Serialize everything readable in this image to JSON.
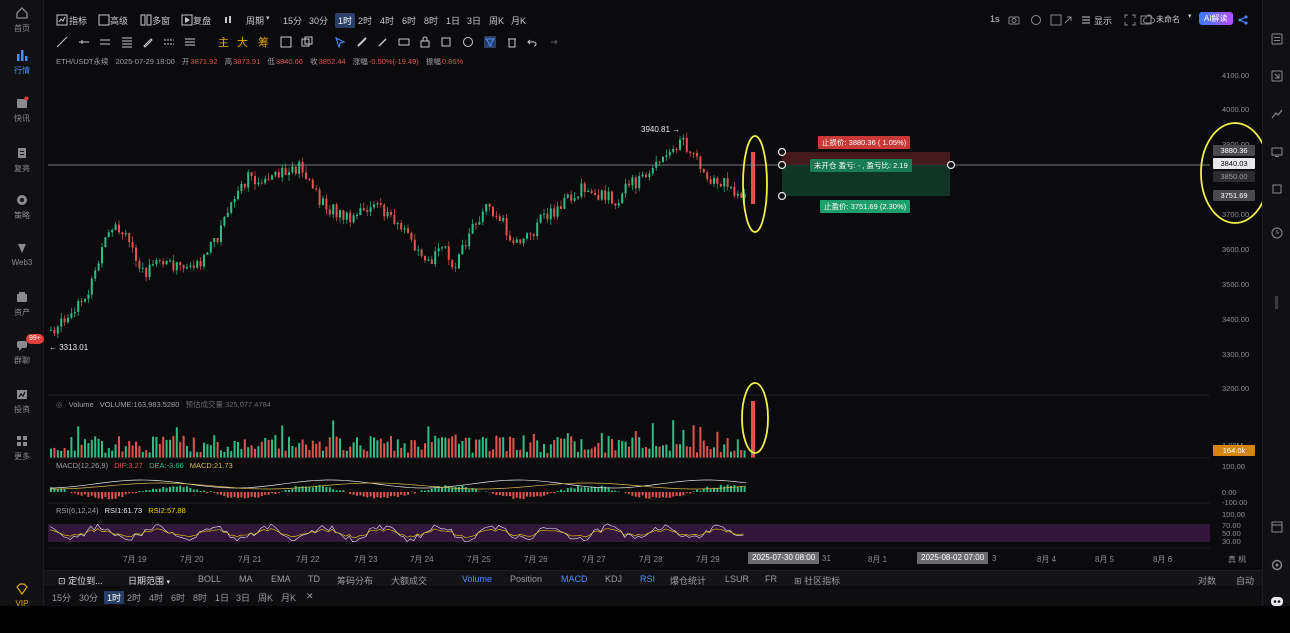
{
  "left_nav": [
    {
      "label": "首页",
      "icon": "home-icon"
    },
    {
      "label": "行情",
      "icon": "chart-bars-icon",
      "active": true
    },
    {
      "label": "快讯",
      "icon": "newsflash-icon"
    },
    {
      "label": "复亮",
      "icon": "document-icon"
    },
    {
      "label": "策略",
      "icon": "strategy-icon"
    },
    {
      "label": "Web3",
      "icon": "web3-icon"
    },
    {
      "label": "资产",
      "icon": "asset-icon"
    },
    {
      "label": "群聊",
      "icon": "chat-icon",
      "badge": "99+"
    },
    {
      "label": "投资",
      "icon": "invest-icon"
    },
    {
      "label": "更多",
      "icon": "more-icon"
    }
  ],
  "vip_label": "VIP",
  "toolbar": {
    "items": [
      "指标",
      "高级",
      "多窗",
      "复盘"
    ],
    "period_label": "周期",
    "timeframes": [
      "15分",
      "30分",
      "1时",
      "2时",
      "4时",
      "6时",
      "8时",
      "1日",
      "3日",
      "周K",
      "月K"
    ],
    "active_timeframe": "1时",
    "right_items": [
      "1s",
      "显示",
      "未命名",
      "AI解读"
    ]
  },
  "drawing_gold": [
    "主",
    "大",
    "筹"
  ],
  "ohlc": {
    "symbol": "ETH/USDT永续",
    "datetime": "2025-07-29 18:00",
    "open_label": "开",
    "open": "3871.92",
    "high_label": "高",
    "high": "3873.91",
    "low_label": "低",
    "low": "3840.66",
    "close_label": "收",
    "close": "3852.44",
    "change_label": "涨幅",
    "change": "-0.50%(-19.49)",
    "amp_label": "振幅",
    "amp": "0.86%"
  },
  "y_axis": [
    "4100.00",
    "4000.00",
    "3900.00",
    "3800.00",
    "3700.00",
    "3600.00",
    "3500.00",
    "3400.00",
    "3300.00",
    "3200.00"
  ],
  "price_tags": {
    "stop_loss_top": "3880.36",
    "current": "3840.03",
    "mid": "3850.00",
    "take_profit": "3751.69"
  },
  "annotations": {
    "high": "3940.81 →",
    "low": "← 3313.01"
  },
  "trade_plan": {
    "stop_loss": "止损价: 3880.36 ( 1.05%)",
    "status": "未开仓  盈亏: - ,  盈亏比: 2.19",
    "take_profit": "止盈价: 3751.69 (2.30%)"
  },
  "volume": {
    "label": "Volume",
    "value": "VOLUME:163,983.5280",
    "est_label": "预估成交量:",
    "est": "325,077.4784",
    "axis": "1.00M",
    "tag": "164.0k"
  },
  "macd": {
    "label": "MACD(12,26,9)",
    "dif": "DIF:3.27",
    "dea": "DEA:-3.66",
    "macd": "MACD:21.73",
    "axis": [
      "100.00",
      "0.00",
      "-100.00"
    ]
  },
  "rsi": {
    "label": "RSI(6,12,24)",
    "rsi1": "RSI1:61.73",
    "rsi2": "RSI2:57.88",
    "axis": [
      "100.00",
      "70.00",
      "50.00",
      "30.00"
    ]
  },
  "x_axis": [
    "7月 19",
    "7月 20",
    "7月 21",
    "7月 22",
    "7月 23",
    "7月 24",
    "7月 25",
    "7月 26",
    "7月 27",
    "7月 28",
    "7月 29",
    "31",
    "8月 1",
    "3",
    "8月 4",
    "8月 5",
    "8月 6"
  ],
  "x_tags": [
    "2025-07-30 08:00",
    "2025-08-02 07:00"
  ],
  "x_right": "真 桃",
  "bottom_bar1": {
    "locate": "定位到...",
    "range": "日期范围",
    "indicators": [
      "BOLL",
      "MA",
      "EMA",
      "TD",
      "筹码分布",
      "大额成交"
    ],
    "sub_indicators": [
      "Volume",
      "Position",
      "MACD",
      "KDJ",
      "RSI",
      "爆仓统计",
      "LSUR",
      "FR",
      "社区指标"
    ],
    "right": [
      "对数",
      "自动"
    ]
  },
  "bottom_bar2": [
    "15分",
    "30分",
    "1时",
    "2时",
    "4时",
    "6时",
    "8时",
    "1日",
    "3日",
    "周K",
    "月K"
  ],
  "colors": {
    "up": "#2ebd85",
    "down": "#e0534d",
    "accent": "#4a8cff",
    "highlight": "#f0f04a"
  }
}
